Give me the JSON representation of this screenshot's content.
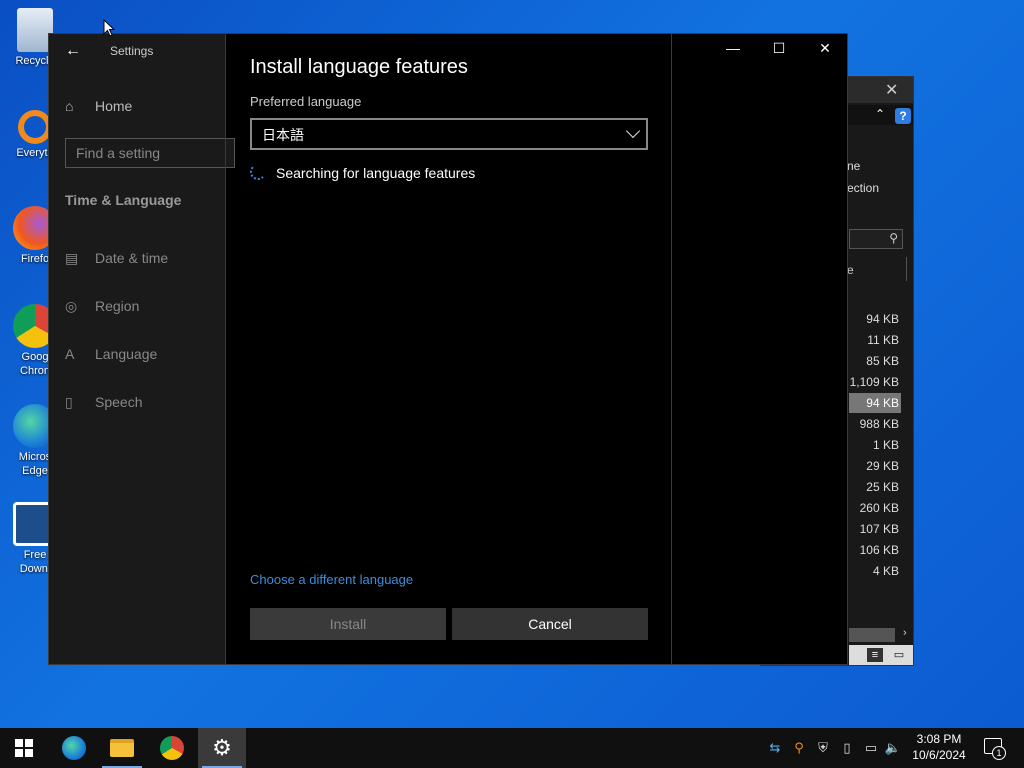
{
  "desktop": {
    "icons": [
      {
        "label": "Recycle"
      },
      {
        "label": "Everyth"
      },
      {
        "label": "Firefo"
      },
      {
        "label": "Goog",
        "label2": "Chron"
      },
      {
        "label": "Micros",
        "label2": "Edge"
      },
      {
        "label": "Free",
        "label2": "Downl"
      }
    ]
  },
  "explorer": {
    "ribbon_lines": [
      "ne",
      "ection"
    ],
    "column_header": "e",
    "sizes": [
      "94 KB",
      "11 KB",
      "85 KB",
      "1,109 KB",
      "94 KB",
      "988 KB",
      "1 KB",
      "29 KB",
      "25 KB",
      "260 KB",
      "107 KB",
      "106 KB",
      "4 KB"
    ],
    "selected_index": 4
  },
  "settings": {
    "app_title": "Settings",
    "home_label": "Home",
    "search_placeholder": "Find a setting",
    "section_title": "Time & Language",
    "nav": [
      {
        "label": "Date & time",
        "icon": "calendar-clock-icon"
      },
      {
        "label": "Region",
        "icon": "globe-icon"
      },
      {
        "label": "Language",
        "icon": "language-icon"
      },
      {
        "label": "Speech",
        "icon": "microphone-icon"
      }
    ]
  },
  "dialog": {
    "title": "Install language features",
    "preferred_label": "Preferred language",
    "selected_language": "日本語",
    "status": "Searching for language features",
    "choose_link": "Choose a different language",
    "install_label": "Install",
    "cancel_label": "Cancel"
  },
  "taskbar": {
    "time": "3:08 PM",
    "date": "10/6/2024",
    "notification_count": "1"
  },
  "colors": {
    "accent": "#3b8ee0",
    "desktop": "#1273e0"
  }
}
